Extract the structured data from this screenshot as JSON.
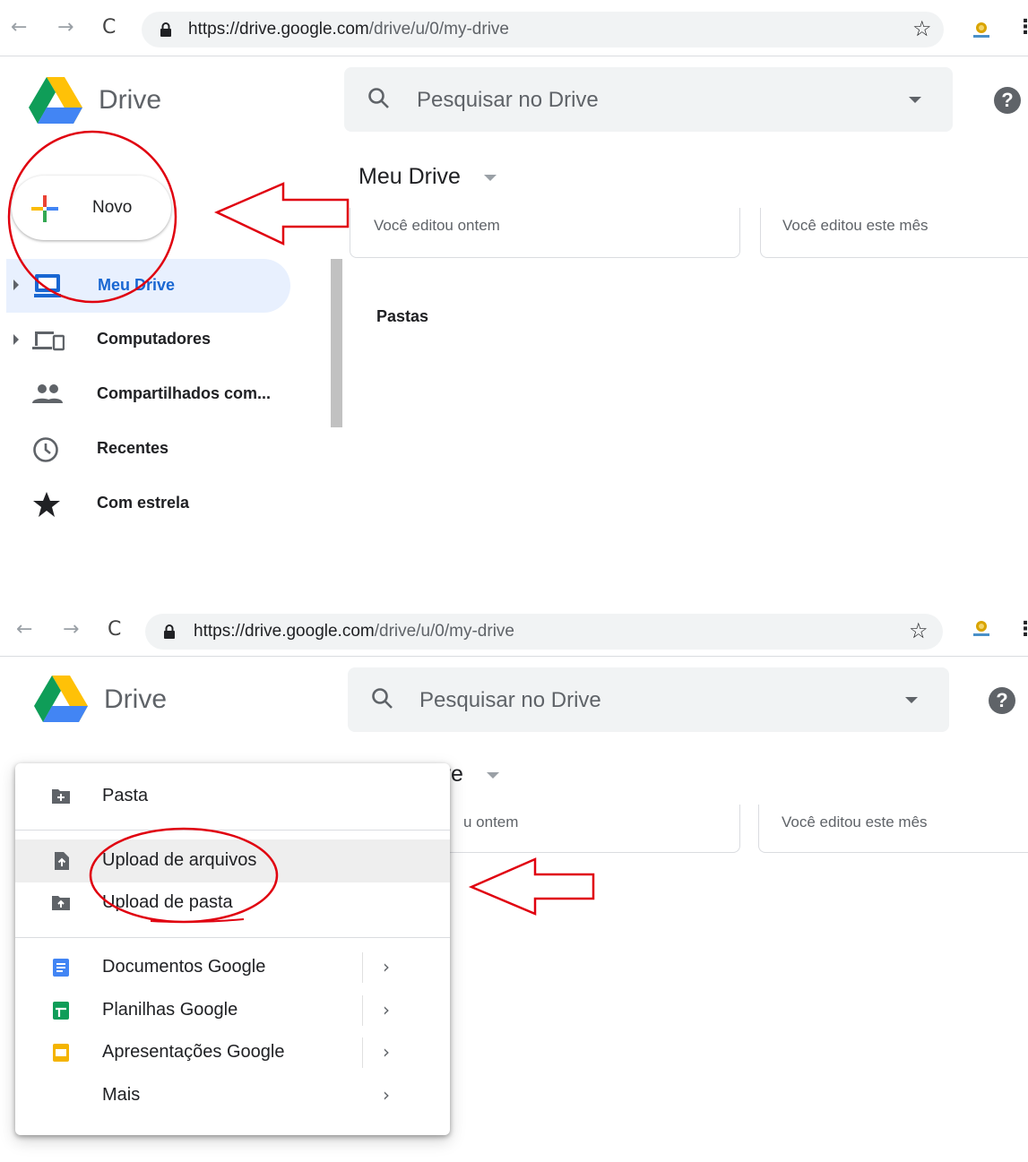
{
  "browser": {
    "back": "←",
    "forward": "→",
    "reload": "C",
    "url_host": "https://drive.google.com",
    "url_path": "/drive/u/0/my-drive",
    "bookmark": "☆",
    "menu": "⋮"
  },
  "app": {
    "name": "Drive",
    "search_placeholder": "Pesquisar no Drive",
    "help": "?"
  },
  "new_button": {
    "label": "Novo"
  },
  "main": {
    "title": "Meu Drive",
    "quick_access": [
      "Você editou ontem",
      "Você editou este mês"
    ],
    "quick_access_partial": "u ontem",
    "folders_heading": "Pastas"
  },
  "sidebar": {
    "items": [
      {
        "label": "Meu Drive",
        "icon": "my-drive-icon",
        "active": true
      },
      {
        "label": "Computadores",
        "icon": "computers-icon"
      },
      {
        "label": "Compartilhados com...",
        "icon": "shared-people-icon"
      },
      {
        "label": "Recentes",
        "icon": "clock-icon"
      },
      {
        "label": "Com estrela",
        "icon": "star-icon"
      }
    ]
  },
  "new_menu": {
    "items": [
      {
        "label": "Pasta",
        "icon": "new-folder-icon"
      },
      {
        "label": "Upload de arquivos",
        "icon": "file-upload-icon",
        "highlighted": true
      },
      {
        "label": "Upload de pasta",
        "icon": "folder-upload-icon"
      },
      {
        "label": "Documentos Google",
        "icon": "google-docs-icon",
        "submenu": "›"
      },
      {
        "label": "Planilhas Google",
        "icon": "google-sheets-icon",
        "submenu": "›"
      },
      {
        "label": "Apresentações Google",
        "icon": "google-slides-icon",
        "submenu": "›"
      },
      {
        "label": "Mais",
        "submenu": "›"
      }
    ]
  },
  "colors": {
    "annotation": "#e0000f",
    "active_nav_bg": "#e8f0fe",
    "active_nav_text": "#1967d2",
    "docs": "#4285f4",
    "sheets": "#0f9d58",
    "slides": "#f4b400"
  }
}
